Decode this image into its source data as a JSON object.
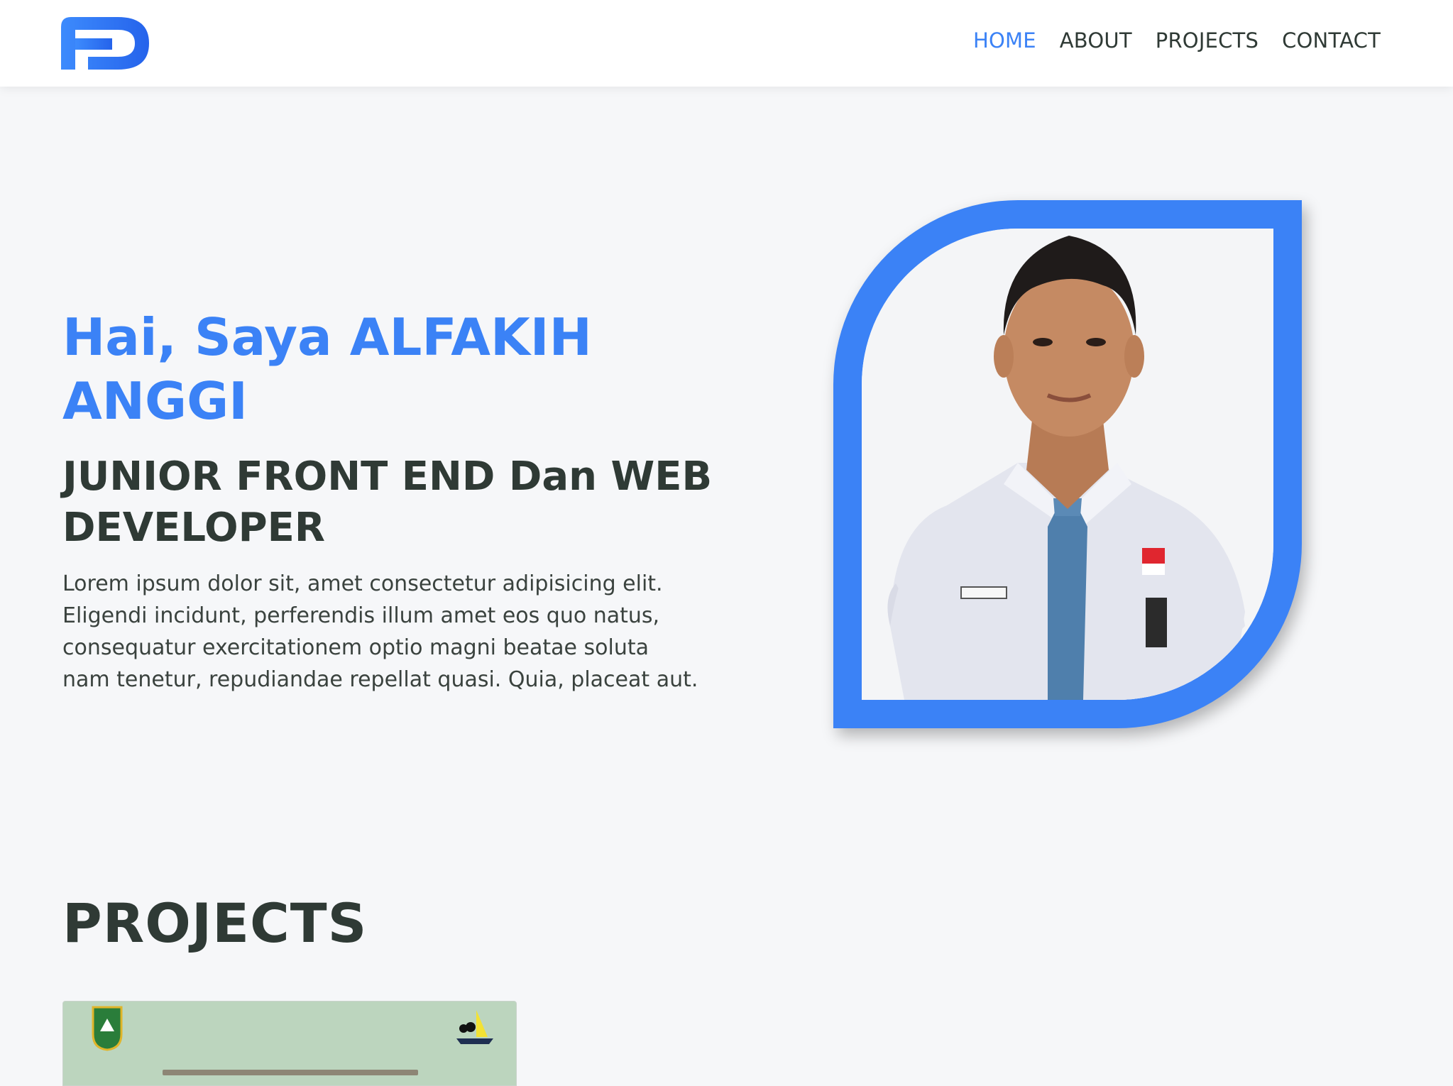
{
  "header": {
    "logo_icon": "fd-logo-icon",
    "nav": [
      {
        "label": "HOME",
        "active": true
      },
      {
        "label": "ABOUT",
        "active": false
      },
      {
        "label": "PROJECTS",
        "active": false
      },
      {
        "label": "CONTACT",
        "active": false
      }
    ]
  },
  "hero": {
    "greeting": "Hai, Saya ALFAKIH ANGGI",
    "role": "JUNIOR FRONT END Dan WEB DEVELOPER",
    "description": "Lorem ipsum dolor sit, amet consectetur adipisicing elit. Eligendi incidunt, perferendis illum amet eos quo natus, consequatur exercitationem optio magni beatae soluta nam tenetur, repudiandae repellat quasi. Quia, placeat aut.",
    "portrait_icon": "portrait-photo",
    "accent_color": "#3b82f6"
  },
  "projects": {
    "title": "PROJECTS",
    "cards": [
      {
        "thumbnail_icon": "project-thumbnail"
      }
    ]
  },
  "colors": {
    "primary": "#3b82f6",
    "text_dark": "#2f3a35",
    "background": "#f6f7f9"
  }
}
